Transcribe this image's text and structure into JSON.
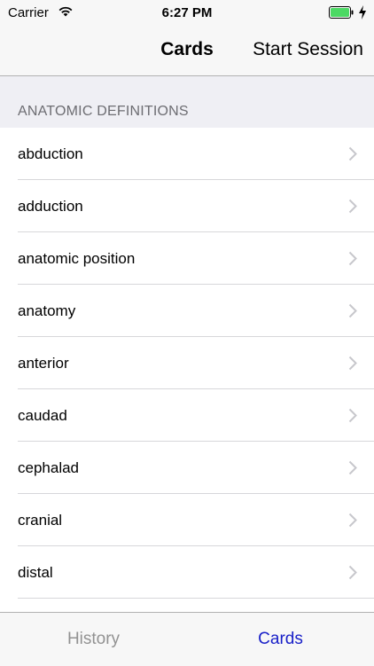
{
  "status_bar": {
    "carrier": "Carrier",
    "time": "6:27 PM",
    "icons": [
      "wifi-icon",
      "battery-icon",
      "charge-icon"
    ]
  },
  "nav_bar": {
    "title": "Cards",
    "action_label": "Start Session"
  },
  "section": {
    "title": "ANATOMIC DEFINITIONS"
  },
  "list": {
    "items": [
      {
        "label": "abduction"
      },
      {
        "label": "adduction"
      },
      {
        "label": "anatomic position"
      },
      {
        "label": "anatomy"
      },
      {
        "label": "anterior"
      },
      {
        "label": "caudad"
      },
      {
        "label": "cephalad"
      },
      {
        "label": "cranial"
      },
      {
        "label": "distal"
      }
    ]
  },
  "tab_bar": {
    "tabs": [
      {
        "label": "History",
        "selected": false
      },
      {
        "label": "Cards",
        "selected": true
      }
    ]
  },
  "colors": {
    "accent": "#1a21c8",
    "battery": "#4cd964",
    "section_bg": "#efeff4",
    "bar_bg": "#f7f7f7",
    "inactive_tab": "#929292"
  }
}
